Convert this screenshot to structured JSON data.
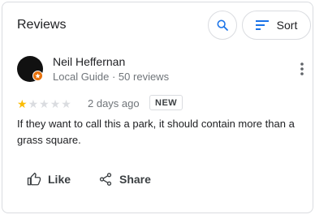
{
  "header": {
    "title": "Reviews",
    "sort_label": "Sort",
    "search_icon": "search-icon",
    "sort_icon": "sort-icon"
  },
  "review": {
    "author_name": "Neil Heffernan",
    "author_meta": "Local Guide · 50 reviews",
    "local_guide_icon": "local-guide-star-icon",
    "rating": 1,
    "rating_max": 5,
    "time": "2 days ago",
    "new_badge": "NEW",
    "text": "If they want to call this a park, it should contain more than a grass square.",
    "more_icon": "more-vert-icon"
  },
  "actions": {
    "like_label": "Like",
    "share_label": "Share",
    "like_icon": "thumb-up-icon",
    "share_icon": "share-icon"
  },
  "colors": {
    "star_filled": "#fbbc04",
    "star_empty": "#dadce0",
    "accent_blue": "#1a73e8",
    "badge_orange": "#e8710a"
  }
}
